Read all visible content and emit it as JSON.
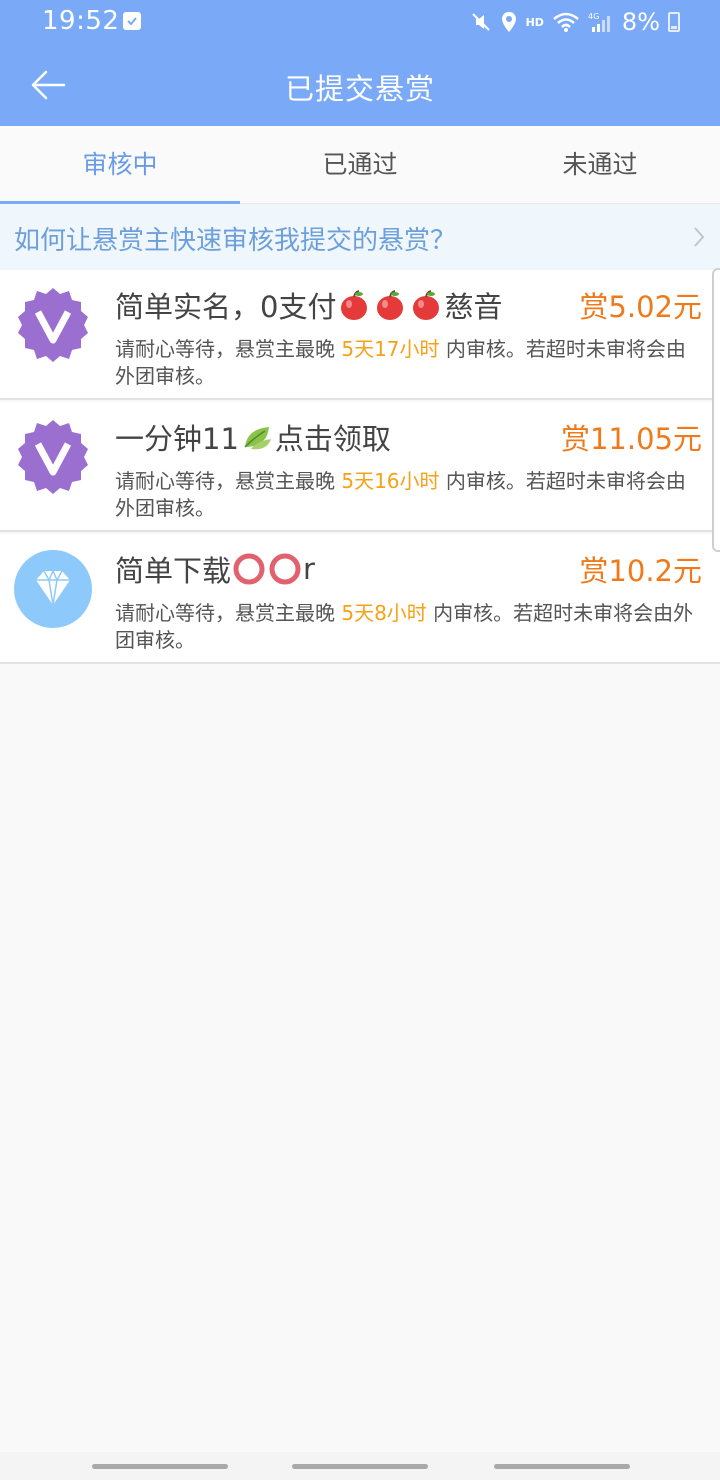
{
  "status_bar": {
    "time": "19:52",
    "hd": "HD",
    "battery": "8%"
  },
  "header": {
    "title": "已提交悬赏"
  },
  "tabs": [
    {
      "label": "审核中",
      "active": true
    },
    {
      "label": "已通过",
      "active": false
    },
    {
      "label": "未通过",
      "active": false
    }
  ],
  "tip": {
    "text": "如何让悬赏主快速审核我提交的悬赏？"
  },
  "tasks": [
    {
      "title_a": "简单实名，0支付",
      "title_b": "慈音",
      "reward": "赏5.02元",
      "desc_prefix": "请耐心等待，悬赏主最晚 ",
      "deadline": "5天17小时",
      "desc_suffix": " 内审核。若超时未审将会由外团审核。",
      "avatar": "v-badge-icon"
    },
    {
      "title_a": "一分钟11",
      "title_b": "点击领取",
      "reward": "赏11.05元",
      "desc_prefix": "请耐心等待，悬赏主最晚 ",
      "deadline": "5天16小时",
      "desc_suffix": " 内审核。若超时未审将会由外团审核。",
      "avatar": "v-badge-icon"
    },
    {
      "title_a": "简单下载",
      "title_b": "r",
      "reward": "赏10.2元",
      "desc_prefix": "请耐心等待，悬赏主最晚 ",
      "deadline": "5天8小时",
      "desc_suffix": " 内审核。若超时未审将会由外团审核。",
      "avatar": "diamond-icon"
    }
  ],
  "colors": {
    "header": "#7aaaf7",
    "accent": "#6a9ce6",
    "reward": "#f07a1a",
    "deadline": "#f6a116",
    "vip_badge": "#9b6fd0",
    "diamond_badge": "#8ec9fb"
  }
}
